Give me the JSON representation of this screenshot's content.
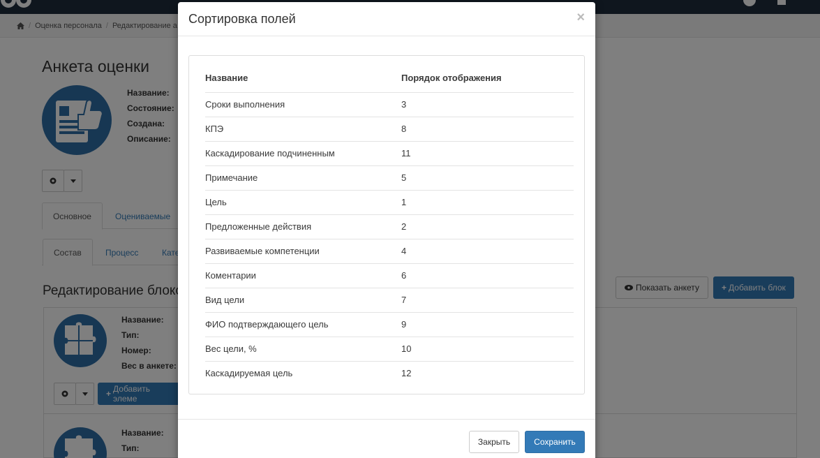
{
  "breadcrumb": {
    "items": [
      "Оценка персонала",
      "Редактирование а"
    ]
  },
  "page": {
    "title": "Анкета оценки",
    "props": [
      "Название:",
      "Состояние:",
      "Создана:",
      "Описание:"
    ],
    "tabs_main": [
      "Основное",
      "Оцениваемые"
    ],
    "tabs_sub": [
      "Состав",
      "Процесс",
      "Кате"
    ],
    "section_title": "Редактирование блоков",
    "show_form_label": "Показать анкету",
    "add_block_label": "Добавить блок",
    "block_props": [
      "Название:",
      "Тип:",
      "Номер:",
      "Вес в анкете:"
    ],
    "block2_props": [
      "Название:",
      "Тип:"
    ],
    "add_element_label": "Добавить элеме"
  },
  "modal": {
    "title": "Сортировка полей",
    "close_symbol": "×",
    "columns": [
      "Название",
      "Порядок отображения"
    ],
    "rows": [
      {
        "name": "Сроки выполнения",
        "order": "3"
      },
      {
        "name": "КПЭ",
        "order": "8"
      },
      {
        "name": "Каскадирование подчиненным",
        "order": "11"
      },
      {
        "name": "Примечание",
        "order": "5"
      },
      {
        "name": "Цель",
        "order": "1"
      },
      {
        "name": "Предложенные действия",
        "order": "2"
      },
      {
        "name": "Развиваемые компетенции",
        "order": "4"
      },
      {
        "name": "Коментарии",
        "order": "6"
      },
      {
        "name": "Вид цели",
        "order": "7"
      },
      {
        "name": "ФИО подтверждающего цель",
        "order": "9"
      },
      {
        "name": "Вес цели, %",
        "order": "10"
      },
      {
        "name": "Каскадируемая цель",
        "order": "12"
      }
    ],
    "close_label": "Закрыть",
    "save_label": "Сохранить"
  },
  "colors": {
    "primary": "#337ab7",
    "topbar": "#1f2d3d",
    "backdrop": "rgba(0,0,0,0.5)"
  }
}
